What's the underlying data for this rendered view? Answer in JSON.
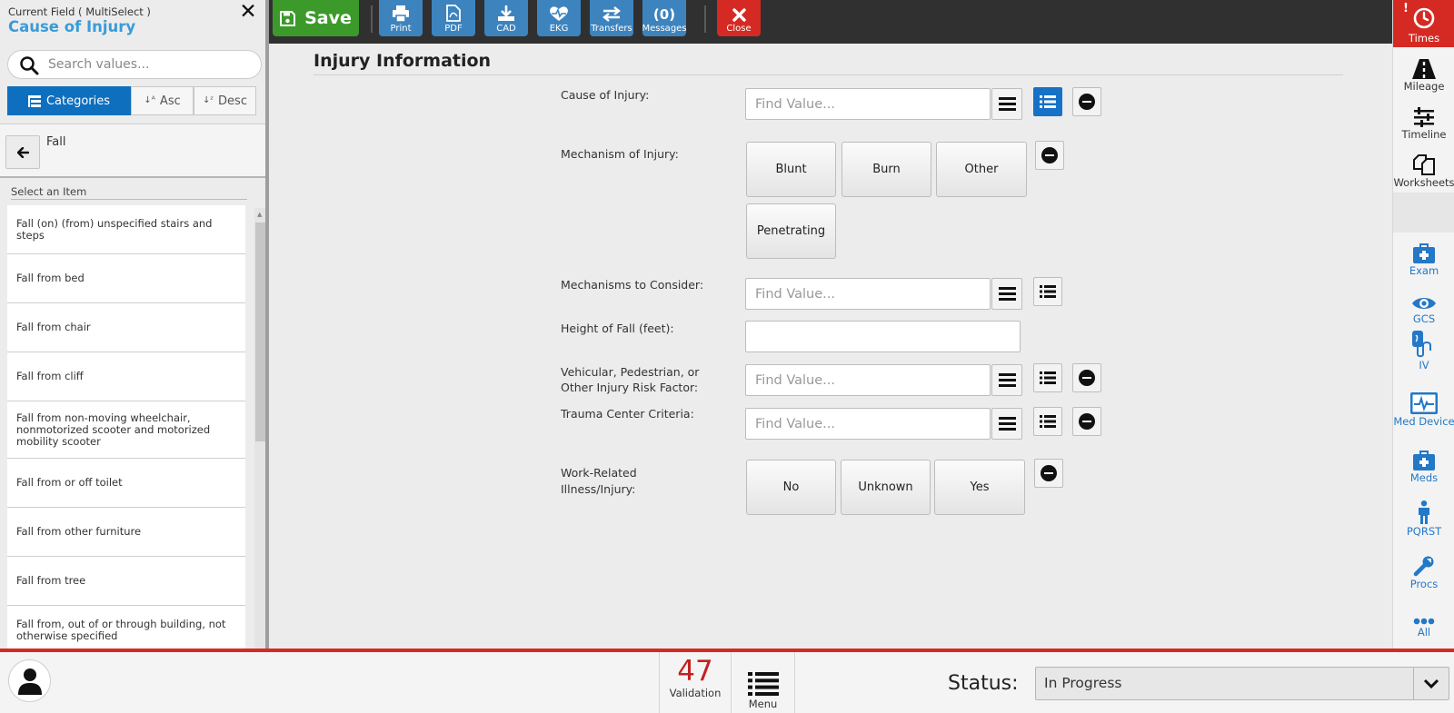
{
  "left_panel": {
    "field_type": "Current Field ( MultiSelect )",
    "field_name": "Cause of Injury",
    "search_placeholder": "Search values...",
    "sort_buttons": {
      "categories": "Categories",
      "asc": "Asc",
      "desc": "Desc"
    },
    "breadcrumb": "Fall",
    "list_header": "Select an Item",
    "items": [
      "Fall (on) (from) unspecified stairs and steps",
      "Fall from bed",
      "Fall from chair",
      "Fall from cliff",
      "Fall from non-moving wheelchair, nonmotorized scooter and motorized mobility scooter",
      "Fall from or off toilet",
      "Fall from other furniture",
      "Fall from tree",
      "Fall from, out of or through building, not otherwise specified"
    ]
  },
  "toolbar": {
    "save": "Save",
    "print": "Print",
    "pdf": "PDF",
    "cad": "CAD",
    "ekg": "EKG",
    "transfers": "Transfers",
    "messages_count": "(0)",
    "messages": "Messages",
    "close": "Close"
  },
  "sidebar": {
    "alert": "!",
    "times": "Times",
    "mileage": "Mileage",
    "timeline": "Timeline",
    "worksheets": "Worksheets",
    "exam": "Exam",
    "gcs": "GCS",
    "iv": "IV",
    "med_device": "Med Device",
    "meds": "Meds",
    "pqrst": "PQRST",
    "procs": "Procs",
    "all": "All"
  },
  "form": {
    "title": "Injury Information",
    "find_placeholder": "Find Value...",
    "cause_label": "Cause of Injury:",
    "mechanism_label": "Mechanism of Injury:",
    "mechanism_options": [
      "Blunt",
      "Burn",
      "Other",
      "Penetrating"
    ],
    "consider_label": "Mechanisms to Consider:",
    "height_label": "Height of Fall (feet):",
    "height_value": "",
    "vehicular_label_1": "Vehicular, Pedestrian, or",
    "vehicular_label_2": "Other Injury Risk Factor:",
    "trauma_label": "Trauma Center Criteria:",
    "work_label_1": "Work-Related",
    "work_label_2": "Illness/Injury:",
    "work_options": [
      "No",
      "Unknown",
      "Yes"
    ]
  },
  "bottom": {
    "validation_count": "47",
    "validation": "Validation",
    "menu": "Menu",
    "status_label": "Status:",
    "status_value": "In Progress"
  },
  "colors": {
    "save_green": "#3c9a2b",
    "toolbar_blue": "#3d84bf",
    "close_red": "#d42a23",
    "active_blue": "#0f6fbf",
    "field_name_blue": "#3a9bd9",
    "sidebar_blue": "#2378c7"
  }
}
